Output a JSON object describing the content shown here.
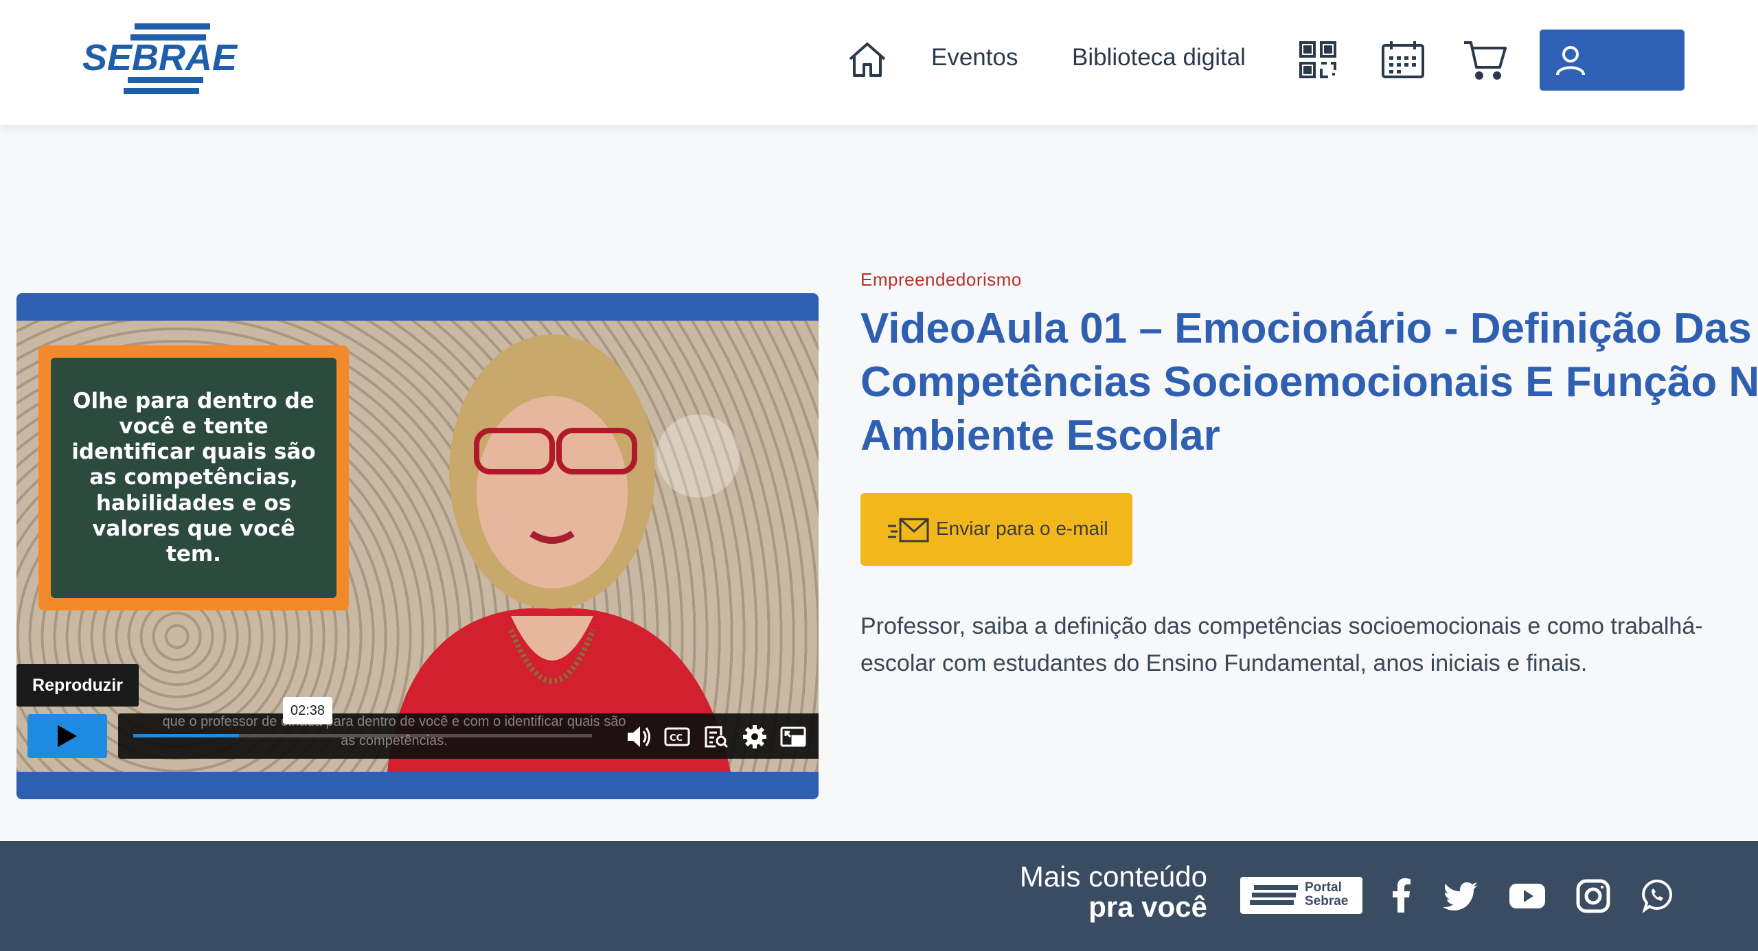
{
  "header": {
    "logo_text": "SEBRAE",
    "nav": {
      "eventos": "Eventos",
      "biblioteca": "Biblioteca digital"
    },
    "icons": [
      "home-icon",
      "qr-code-icon",
      "calendar-icon",
      "cart-icon",
      "user-icon"
    ]
  },
  "video": {
    "chalkboard_text": "Olhe para dentro de você e tente identificar quais são as competências, habilidades e os valores que você tem.",
    "play_tooltip": "Reproduzir",
    "time_tooltip": "02:38",
    "subtitle": "que o professor de olhada para dentro de você e com o identificar quais são as competências.",
    "progress_fraction": 0.23,
    "controls": [
      "play-icon",
      "volume-icon",
      "captions-icon",
      "transcript-icon",
      "settings-icon",
      "picture-in-picture-icon"
    ]
  },
  "content": {
    "category": "Empreendedorismo",
    "title": "VideoAula 01 – Emocionário - Definição Das\nCompetências Socioemocionais E Função No\nAmbiente Escolar",
    "email_button": "Enviar para o e-mail",
    "description": "Professor, saiba a definição das competências socioemocionais e como trabalhá-\nescolar com estudantes do Ensino Fundamental, anos iniciais e finais."
  },
  "footer": {
    "mais_line1": "Mais conteúdo",
    "mais_line2": "pra você",
    "portal_line1": "Portal",
    "portal_line2": "Sebrae",
    "social": [
      "facebook-icon",
      "twitter-icon",
      "youtube-icon",
      "instagram-icon",
      "whatsapp-icon"
    ]
  },
  "colors": {
    "brand_blue": "#2f5fb1",
    "button_yellow": "#f2b81b",
    "category_red": "#b5312a",
    "footer_bg": "#3a4c62",
    "player_blue": "#1e8be0"
  }
}
